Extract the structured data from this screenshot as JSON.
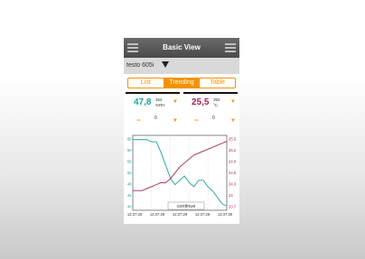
{
  "app": {
    "title": "Basic View"
  },
  "device": {
    "name": "testo 605i"
  },
  "tabs": [
    {
      "label": "List",
      "active": false
    },
    {
      "label": "Trending",
      "active": true
    },
    {
      "label": "Table",
      "active": false
    }
  ],
  "readouts": [
    {
      "value": "47,8",
      "channel": "352",
      "unit": "%RH",
      "color": "#1aa3a3"
    },
    {
      "value": "25,5",
      "channel": "352",
      "unit": "°C",
      "color": "#a0235a"
    }
  ],
  "empty_readouts": [
    {
      "value": "---",
      "channel": "0"
    },
    {
      "value": "---",
      "channel": "0"
    }
  ],
  "chart": {
    "continue_label": "continue",
    "left_ticks": [
      "68",
      "60",
      "56",
      "52",
      "48",
      "44",
      "40"
    ],
    "right_ticks": [
      "25.5",
      "25.2",
      "24.9",
      "24.6",
      "24.3",
      "24",
      "23.7"
    ],
    "x_ticks": [
      "13:37:28",
      "13:37:28",
      "13:37:29",
      "13:37:29",
      "13:37:30"
    ]
  },
  "chart_data": {
    "type": "line",
    "x": [
      0,
      1,
      2,
      3,
      4,
      5,
      6,
      7,
      8,
      9,
      10,
      11,
      12,
      13,
      14,
      15,
      16,
      17,
      18,
      19,
      20
    ],
    "series": [
      {
        "axis": "left",
        "color": "#1aa3a3",
        "values": [
          67,
          67,
          67,
          67,
          66,
          66,
          61,
          55,
          49,
          46,
          48,
          50,
          47,
          45,
          48,
          48,
          45,
          43,
          40,
          37,
          36
        ]
      },
      {
        "axis": "right",
        "color": "#a0235a",
        "values": [
          24.1,
          24.1,
          24.1,
          24.15,
          24.2,
          24.25,
          24.3,
          24.3,
          24.4,
          24.55,
          24.7,
          24.8,
          24.9,
          25.0,
          25.05,
          25.1,
          25.15,
          25.2,
          25.25,
          25.3,
          25.35
        ]
      }
    ],
    "ylim_left": [
      34,
      69
    ],
    "ylim_right": [
      23.6,
      25.5
    ],
    "grid": true
  },
  "colors": {
    "accent": "#f39200",
    "humidity": "#1aa3a3",
    "temperature": "#a0235a"
  }
}
